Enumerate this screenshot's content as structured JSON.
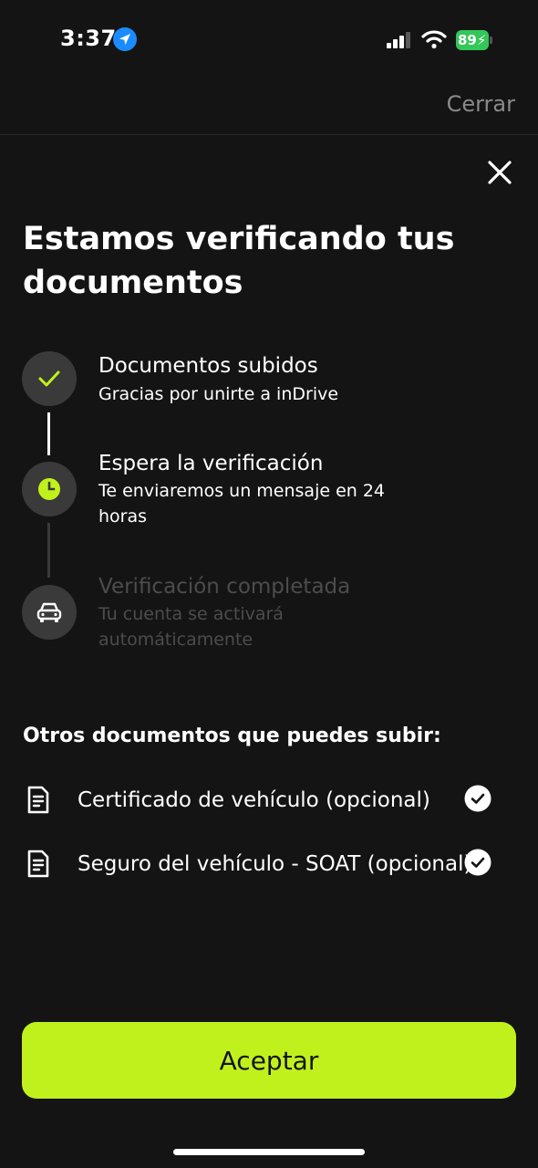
{
  "status_bar": {
    "time": "3:37",
    "battery": "89"
  },
  "header": {
    "close_label": "Cerrar"
  },
  "title": "Estamos verificando tus documentos",
  "steps": [
    {
      "title": "Documentos subidos",
      "subtitle": "Gracias por unirte a inDrive",
      "icon": "checkmark-icon",
      "state": "done"
    },
    {
      "title": "Espera la verificación",
      "subtitle": "Te enviaremos un mensaje en 24 horas",
      "icon": "clock-icon",
      "state": "current"
    },
    {
      "title": "Verificación completada",
      "subtitle": "Tu cuenta se activará automáticamente",
      "icon": "car-icon",
      "state": "pending"
    }
  ],
  "other_documents": {
    "title": "Otros documentos que puedes subir:",
    "items": [
      {
        "label": "Certificado de vehículo (opcional)",
        "icon": "document-icon",
        "checked": true
      },
      {
        "label": "Seguro del vehículo - SOAT (opcional)",
        "icon": "document-icon",
        "checked": true
      }
    ]
  },
  "accept_label": "Aceptar",
  "colors": {
    "background": "#141414",
    "accent": "#c1f11d",
    "step_circle": "#3a3a3a",
    "muted_text": "#4c4c4c",
    "battery": "#33c759",
    "location": "#1a8cff"
  }
}
